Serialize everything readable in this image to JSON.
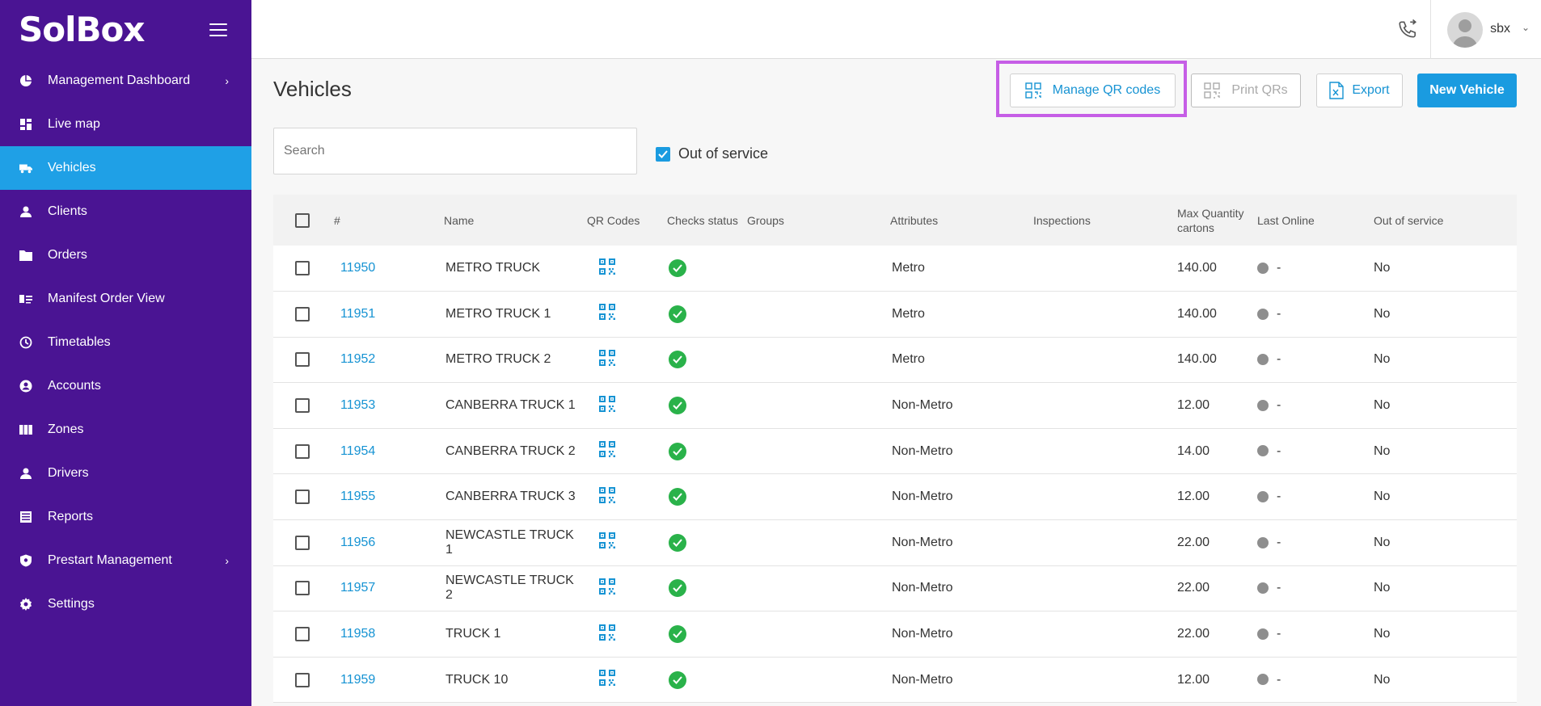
{
  "brand": {
    "logo_text": "SolBox"
  },
  "sidebar": {
    "items": [
      {
        "label": "Management Dashboard",
        "icon": "pie-chart-icon",
        "has_chevron": true
      },
      {
        "label": "Live map",
        "icon": "dashboard-icon",
        "has_chevron": false
      },
      {
        "label": "Vehicles",
        "icon": "truck-icon",
        "has_chevron": false,
        "active": true
      },
      {
        "label": "Clients",
        "icon": "person-icon",
        "has_chevron": false
      },
      {
        "label": "Orders",
        "icon": "folder-icon",
        "has_chevron": false
      },
      {
        "label": "Manifest Order View",
        "icon": "manifest-icon",
        "has_chevron": false
      },
      {
        "label": "Timetables",
        "icon": "clock-icon",
        "has_chevron": false
      },
      {
        "label": "Accounts",
        "icon": "account-circle-icon",
        "has_chevron": false
      },
      {
        "label": "Zones",
        "icon": "map-icon",
        "has_chevron": false
      },
      {
        "label": "Drivers",
        "icon": "person-icon",
        "has_chevron": false
      },
      {
        "label": "Reports",
        "icon": "report-icon",
        "has_chevron": false
      },
      {
        "label": "Prestart Management",
        "icon": "shield-icon",
        "has_chevron": true
      },
      {
        "label": "Settings",
        "icon": "gear-icon",
        "has_chevron": false
      }
    ]
  },
  "header": {
    "username": "sbx"
  },
  "main": {
    "title": "Vehicles",
    "buttons": {
      "manage_qr": "Manage QR codes",
      "print_qr": "Print QRs",
      "export": "Export",
      "new_vehicle": "New Vehicle"
    },
    "search": {
      "placeholder": "Search",
      "value": ""
    },
    "filter_out_of_service": {
      "label": "Out of service",
      "checked": true
    }
  },
  "table": {
    "columns": {
      "id": "#",
      "name": "Name",
      "qr": "QR Codes",
      "checks": "Checks status",
      "groups": "Groups",
      "attributes": "Attributes",
      "inspections": "Inspections",
      "max_qty": "Max Quantity cartons",
      "last_online": "Last Online",
      "out_of_service": "Out of service"
    },
    "rows": [
      {
        "id": "11950",
        "name": "METRO TRUCK",
        "attributes": "Metro",
        "max_qty": "140.00",
        "last_online": "-",
        "out_of_service": "No"
      },
      {
        "id": "11951",
        "name": "METRO TRUCK 1",
        "attributes": "Metro",
        "max_qty": "140.00",
        "last_online": "-",
        "out_of_service": "No"
      },
      {
        "id": "11952",
        "name": "METRO TRUCK 2",
        "attributes": "Metro",
        "max_qty": "140.00",
        "last_online": "-",
        "out_of_service": "No"
      },
      {
        "id": "11953",
        "name": "CANBERRA TRUCK 1",
        "attributes": "Non-Metro",
        "max_qty": "12.00",
        "last_online": "-",
        "out_of_service": "No"
      },
      {
        "id": "11954",
        "name": "CANBERRA TRUCK 2",
        "attributes": "Non-Metro",
        "max_qty": "14.00",
        "last_online": "-",
        "out_of_service": "No"
      },
      {
        "id": "11955",
        "name": "CANBERRA TRUCK 3",
        "attributes": "Non-Metro",
        "max_qty": "12.00",
        "last_online": "-",
        "out_of_service": "No"
      },
      {
        "id": "11956",
        "name": "NEWCASTLE TRUCK 1",
        "attributes": "Non-Metro",
        "max_qty": "22.00",
        "last_online": "-",
        "out_of_service": "No"
      },
      {
        "id": "11957",
        "name": "NEWCASTLE TRUCK 2",
        "attributes": "Non-Metro",
        "max_qty": "22.00",
        "last_online": "-",
        "out_of_service": "No"
      },
      {
        "id": "11958",
        "name": "TRUCK 1",
        "attributes": "Non-Metro",
        "max_qty": "22.00",
        "last_online": "-",
        "out_of_service": "No"
      },
      {
        "id": "11959",
        "name": "TRUCK 10",
        "attributes": "Non-Metro",
        "max_qty": "12.00",
        "last_online": "-",
        "out_of_service": "No"
      }
    ]
  },
  "colors": {
    "sidebar_bg": "#4a1493",
    "active_item": "#1fa0e6",
    "accent": "#1693d3",
    "status_ok": "#2ab24a",
    "highlight": "#c65ee6"
  }
}
